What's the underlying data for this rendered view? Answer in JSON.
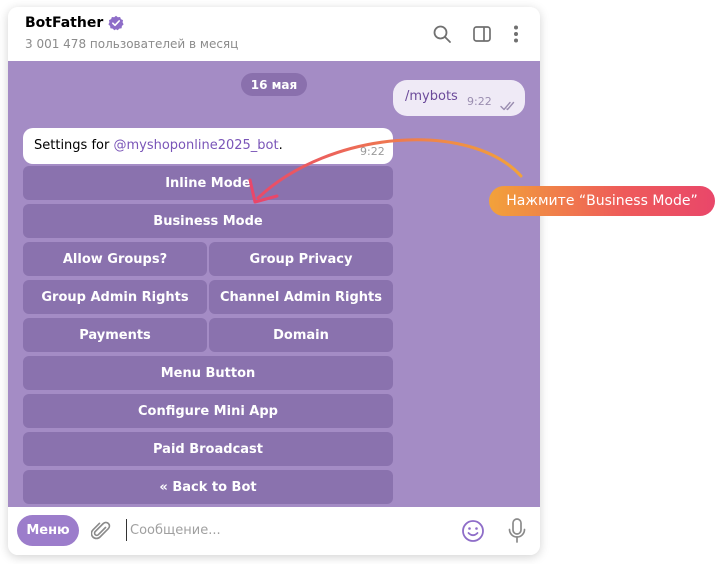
{
  "header": {
    "title": "BotFather",
    "subtitle": "3 001 478 пользователей в месяц"
  },
  "chat": {
    "date": "16 мая",
    "outgoing": {
      "text": "/mybots",
      "time": "9:22"
    },
    "incoming": {
      "prefix": "Settings for ",
      "mention": "@myshoponline2025_bot",
      "suffix": ".",
      "time": "9:22"
    },
    "keyboard": {
      "inline_mode": "Inline Mode",
      "business_mode": "Business Mode",
      "allow_groups": "Allow Groups?",
      "group_privacy": "Group Privacy",
      "group_admin_rights": "Group Admin Rights",
      "channel_admin_rights": "Channel Admin Rights",
      "payments": "Payments",
      "domain": "Domain",
      "menu_button": "Menu Button",
      "configure_mini_app": "Configure Mini App",
      "paid_broadcast": "Paid Broadcast",
      "back_to_bot": "« Back to Bot"
    }
  },
  "composer": {
    "menu_label": "Меню",
    "placeholder": "Сообщение..."
  },
  "annotation": {
    "text": "Нажмите “Business Mode”"
  },
  "colors": {
    "chat_background": "#a48cc5",
    "keyboard_button": "#8a72ae",
    "accent": "#9c7dcb",
    "callout_start": "#f2a23a",
    "callout_end": "#e9476a"
  },
  "icons": {
    "verified": "verified-badge-icon",
    "search": "search-icon",
    "sidebar": "sidebar-toggle-icon",
    "more": "more-vertical-icon",
    "read": "double-check-icon",
    "attach": "paperclip-icon",
    "emoji": "emoji-icon",
    "mic": "microphone-icon"
  }
}
